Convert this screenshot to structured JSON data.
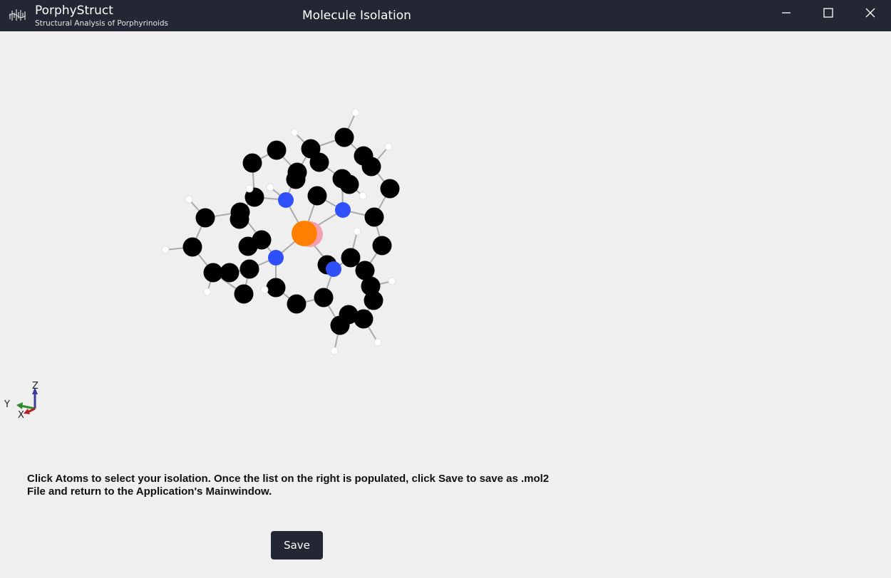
{
  "titlebar": {
    "app_name": "PorphyStruct",
    "app_subtitle": "Structural Analysis of Porphyrinoids",
    "window_title": "Molecule Isolation"
  },
  "viewport": {
    "axes": {
      "x": "X",
      "y": "Y",
      "z": "Z"
    }
  },
  "instructions": "Click Atoms to select your isolation. Once the list on the right is populated, click Save to save as .mol2 File and return to the Application's Mainwindow.",
  "save_button": {
    "label": "Save"
  },
  "colors": {
    "titlebar_bg": "#222733",
    "background": "#efefef",
    "carbon": "#000000",
    "nitrogen": "#2f50f8",
    "hydrogen": "#ffffff",
    "metal": "#ff8000",
    "metal_secondary": "#f4a0b0",
    "bond": "#aaaaaa",
    "axis_x": "#b22222",
    "axis_y": "#2e8b2e",
    "axis_z": "#3b3b9a"
  },
  "icons": {
    "app_logo": "porphystruct-logo-icon",
    "minimize": "minimize-icon",
    "maximize": "maximize-icon",
    "close": "close-icon"
  }
}
